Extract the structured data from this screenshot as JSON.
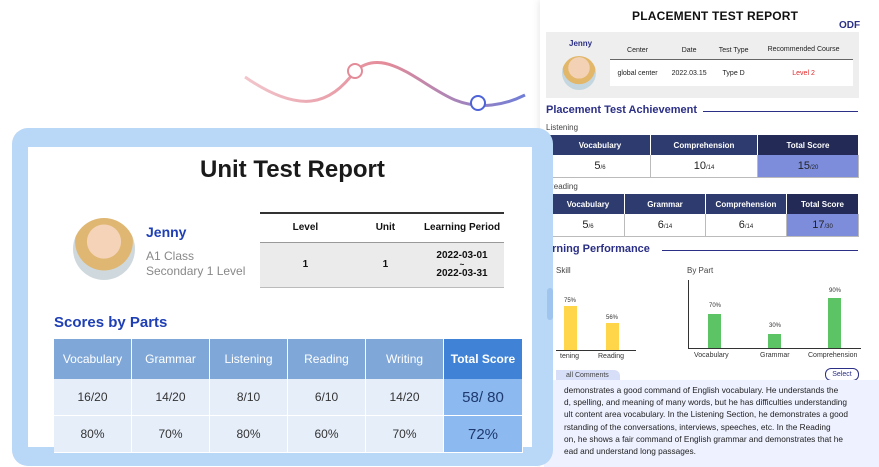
{
  "placement": {
    "title": "PLACEMENT TEST REPORT",
    "badge": "ODF",
    "student": "Jenny",
    "info_headers": [
      "Center",
      "Date",
      "Test Type",
      "Recommended Course"
    ],
    "info_values": [
      "global center",
      "2022.03.15",
      "Type D",
      "Level 2"
    ],
    "achievement_title": "Placement Test Achievement",
    "listening_label": "Listening",
    "listening": {
      "headers": [
        "Vocabulary",
        "Comprehension",
        "Total Score"
      ],
      "scores": [
        "5",
        "10",
        "15"
      ],
      "outof": [
        "/6",
        "/14",
        "/20"
      ]
    },
    "reading_label": "Reading",
    "reading": {
      "headers": [
        "Vocabulary",
        "Grammar",
        "Comprehension",
        "Total Score"
      ],
      "scores": [
        "5",
        "6",
        "6",
        "17"
      ],
      "outof": [
        "/6",
        "/14",
        "/14",
        "/30"
      ]
    },
    "performance_title": "arning Performance",
    "by_skill_label": "Skill",
    "by_part_label": "By Part",
    "by_skill": {
      "labels": [
        "tening",
        "Reading"
      ],
      "values": [
        "75%",
        "56%"
      ]
    },
    "by_part": {
      "labels": [
        "Vocabulary",
        "Grammar",
        "Comprehension"
      ],
      "values": [
        "70%",
        "30%",
        "90%"
      ]
    },
    "comments_label": "all Comments",
    "select_label": "Select",
    "comment_lines": [
      "demonstrates a good command of English vocabulary. He understands the",
      "d, spelling, and meaning of many words, but he has difficulties understanding",
      "ult content area vocabulary. In the Listening Section, he demonstrates a good",
      "rstanding of the conversations, interviews, speeches, etc. In the Reading",
      "on, he shows a fair command of English grammar and demonstrates that he",
      "ead and understand long passages."
    ]
  },
  "unit": {
    "title": "Unit Test Report",
    "name": "Jenny",
    "class": "A1 Class",
    "level": "Secondary 1 Level",
    "headers": [
      "Level",
      "Unit",
      "Learning Period"
    ],
    "values": [
      "1",
      "1",
      "2022-03-01\n~\n2022-03-31"
    ],
    "period_start": "2022-03-01",
    "period_sep": "~",
    "period_end": "2022-03-31",
    "scores_title": "Scores by Parts",
    "parts": [
      "Vocabulary",
      "Grammar",
      "Listening",
      "Reading",
      "Writing",
      "Total Score"
    ],
    "scores": [
      "16/20",
      "14/20",
      "8/10",
      "6/10",
      "14/20",
      "58/ 80"
    ],
    "percents": [
      "80%",
      "70%",
      "80%",
      "60%",
      "70%",
      "72%"
    ]
  },
  "colors": {
    "navy": "#2b2f86",
    "accent_blue": "#1e3fb5",
    "total_cell": "#8cb9ef",
    "bar_yellow": "#ffd54a",
    "bar_green": "#5dc466"
  }
}
